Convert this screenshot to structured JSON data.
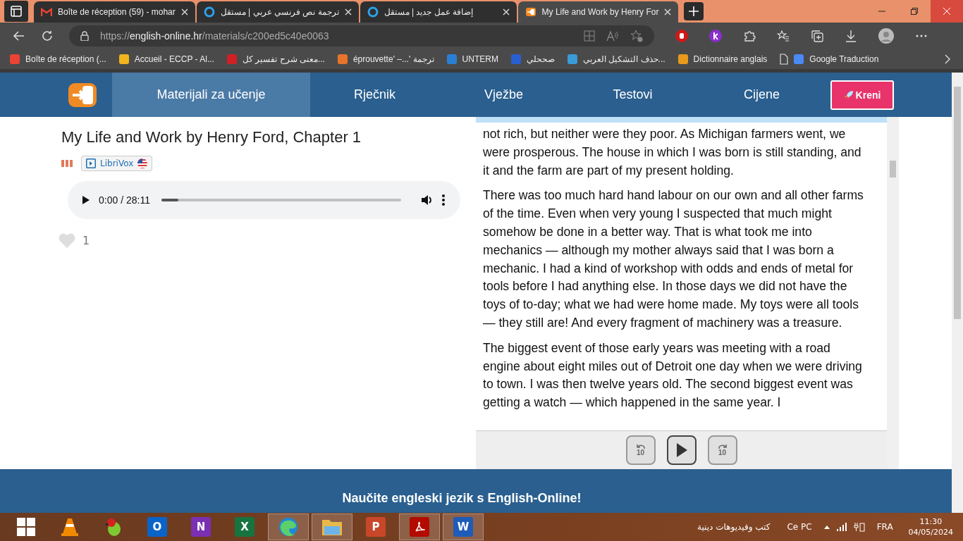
{
  "browser": {
    "tabs": [
      {
        "title": "Boîte de réception (59) - mohar",
        "selected": false
      },
      {
        "title": "ترجمة نص فرنسي عربي | مستقل",
        "selected": false
      },
      {
        "title": "إضافة عمل جديد | مستقل",
        "selected": false
      },
      {
        "title": "My Life and Work by Henry For",
        "selected": true
      }
    ],
    "address": {
      "scheme": "https://",
      "host": "english-online.hr",
      "path": "/materials/c200ed5c40e0063"
    },
    "bookmarks": [
      {
        "label": "Boîte de réception (..."
      },
      {
        "label": "Accueil - ECCP - Al..."
      },
      {
        "label": "معنى شرح تفسير كل..."
      },
      {
        "label": "éprouvette' –...' ترجمة"
      },
      {
        "label": "UNTERM"
      },
      {
        "label": "صححلي"
      },
      {
        "label": "حذف التشكيل العربي..."
      },
      {
        "label": "Dictionnaire anglais"
      },
      {
        "label": "Google Traduction"
      }
    ]
  },
  "site": {
    "nav": [
      {
        "label": "Materijali za učenje",
        "selected": true
      },
      {
        "label": "Rječnik",
        "selected": false
      },
      {
        "label": "Vježbe",
        "selected": false
      },
      {
        "label": "Testovi",
        "selected": false
      },
      {
        "label": "Cijene",
        "selected": false
      }
    ],
    "cta": "Kreni",
    "title": "My Life and Work by Henry Ford, Chapter 1",
    "source": "LibriVox",
    "audio": {
      "time": "0:00 / 28:11",
      "level": 0.07
    },
    "likes": "1",
    "paragraphs": [
      "not rich, but neither were they poor. As Michigan farmers went, we were prosperous. The house in which I was born is still standing, and it and the farm are part of my present holding.",
      "There was too much hard hand labour on our own and all other farms of the time. Even when very young I suspected that much might somehow be done in a better way. That is what took me into mechanics — although my mother always said that I was born a mechanic. I had a kind of workshop with odds and ends of metal for tools before I had anything else. In those days we did not have the toys of to-day; what we had were home made. My toys were all tools — they still are! And every fragment of machinery was a treasure.",
      "The biggest event of those early years was meeting with a road engine about eight miles out of Detroit one day when we were driving to town. I was then twelve years old. The second biggest event was getting a watch — which happened in the same year. I"
    ],
    "skip_back": "10",
    "skip_forward": "10",
    "footer": "Naučite engleski jezik s English-Online!"
  },
  "taskbar": {
    "apps": [
      {
        "kind": "start",
        "active": false
      },
      {
        "kind": "vlc",
        "active": false
      },
      {
        "kind": "parrot",
        "active": false
      },
      {
        "kind": "tile",
        "letter": "O",
        "color": "#0a64c8",
        "active": false
      },
      {
        "kind": "tile",
        "letter": "N",
        "color": "#7b2fb3",
        "active": false
      },
      {
        "kind": "tile",
        "letter": "X",
        "color": "#17733f",
        "active": false
      },
      {
        "kind": "edge",
        "active": true
      },
      {
        "kind": "folder",
        "active": true
      },
      {
        "kind": "tile",
        "letter": "P",
        "color": "#c8472a",
        "active": false
      },
      {
        "kind": "tile",
        "color": "#b30b00",
        "active": true
      },
      {
        "kind": "tile",
        "letter": "W",
        "color": "#1f5cb8",
        "active": true
      }
    ],
    "toolbar_label": "كتب وفيديوهات دينية",
    "pc_label": "Ce PC",
    "lang": "FRA",
    "time": "11:30",
    "date": "04/05/2024"
  }
}
